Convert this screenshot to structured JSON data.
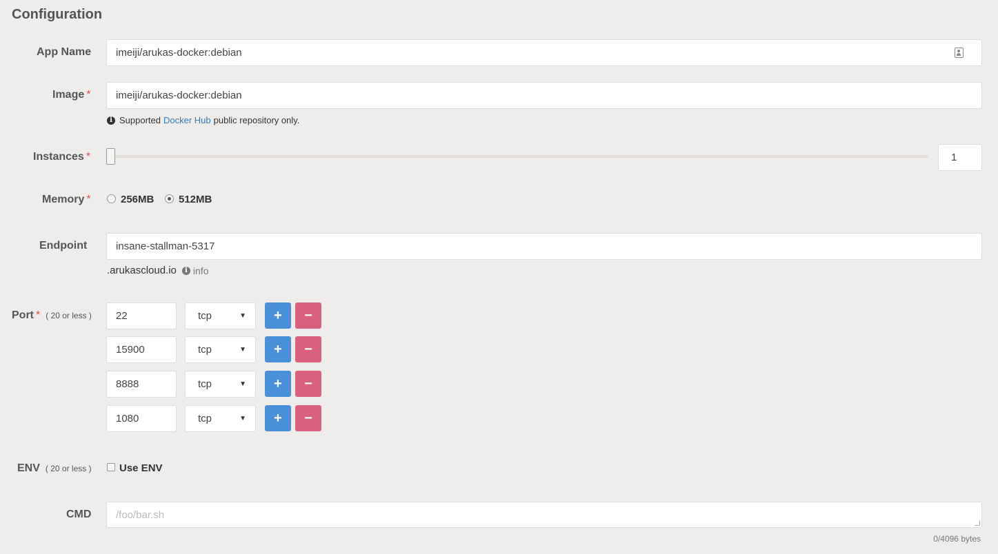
{
  "heading": "Configuration",
  "app_name": {
    "label": "App Name",
    "value": "imeiji/arukas-docker:debian"
  },
  "image": {
    "label": "Image",
    "required": "*",
    "value": "imeiji/arukas-docker:debian",
    "help_prefix": "Supported",
    "help_link": "Docker Hub",
    "help_suffix": "public repository only."
  },
  "instances": {
    "label": "Instances",
    "required": "*",
    "value": "1",
    "slider_fraction": 0.0
  },
  "memory": {
    "label": "Memory",
    "required": "*",
    "options": [
      "256MB",
      "512MB"
    ],
    "selected": "512MB"
  },
  "endpoint": {
    "label": "Endpoint",
    "value": "insane-stallman-5317",
    "suffix": ".arukascloud.io",
    "info": "info"
  },
  "port": {
    "label": "Port",
    "required": "*",
    "limit": "( 20 or less )",
    "rows": [
      {
        "number": "22",
        "protocol": "tcp"
      },
      {
        "number": "15900",
        "protocol": "tcp"
      },
      {
        "number": "8888",
        "protocol": "tcp"
      },
      {
        "number": "1080",
        "protocol": "tcp"
      }
    ],
    "add_label": "+",
    "remove_label": "−"
  },
  "env": {
    "label": "ENV",
    "limit": "( 20 or less )",
    "checkbox_label": "Use ENV",
    "checked": false
  },
  "cmd": {
    "label": "CMD",
    "placeholder": "/foo/bar.sh",
    "counter": "0/4096 bytes"
  },
  "icons": {
    "info": "info-icon",
    "contact": "contact-card-icon",
    "caret": "caret-down-icon"
  }
}
